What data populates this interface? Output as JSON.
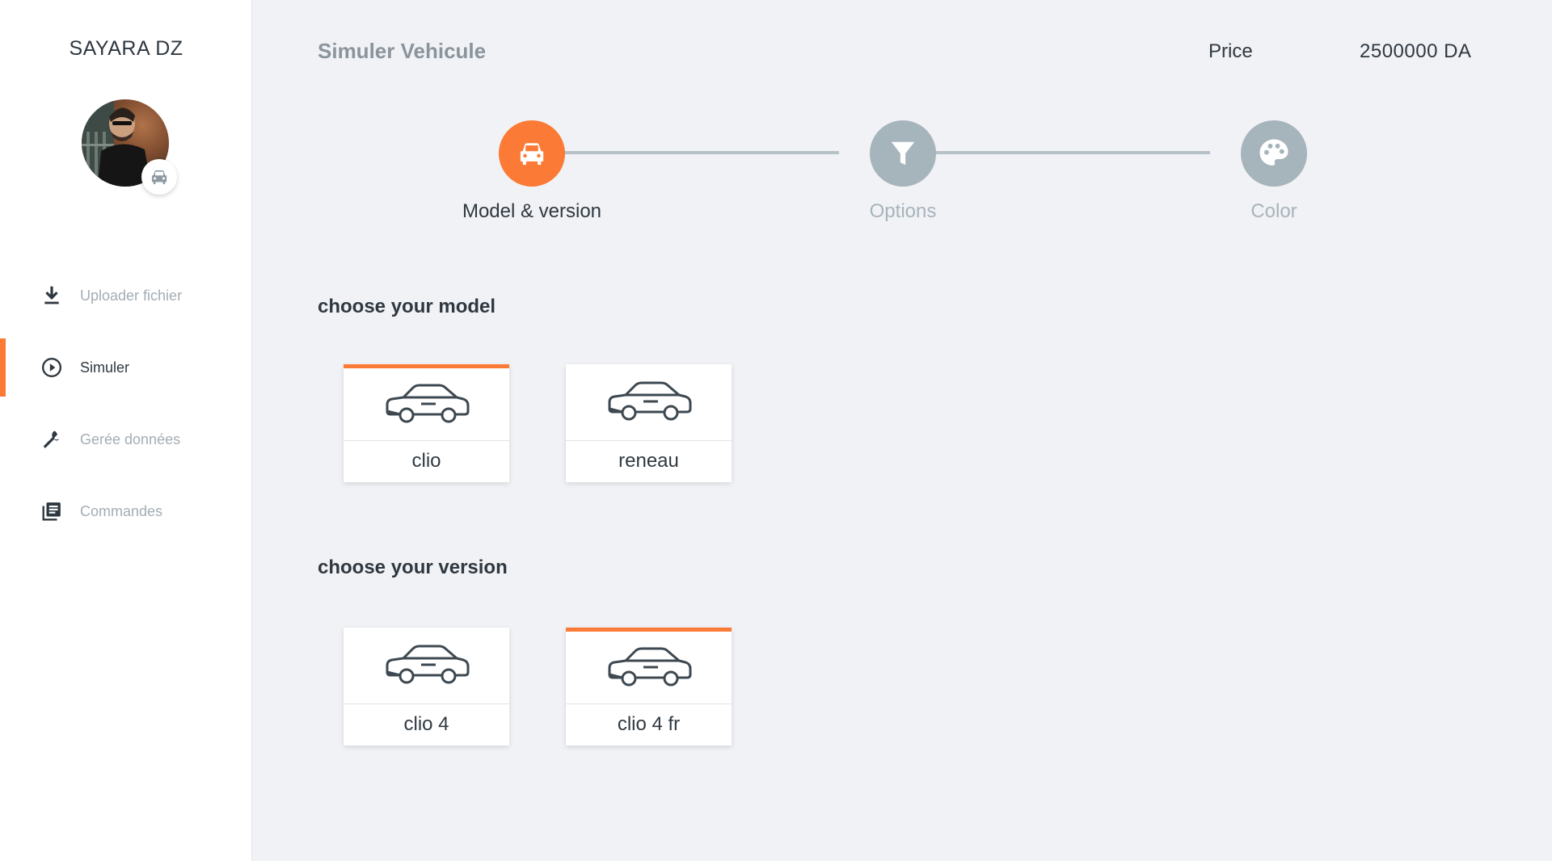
{
  "app": {
    "brand": "SAYARA DZ"
  },
  "sidebar": {
    "items": [
      {
        "label": "Uploader fichier",
        "icon": "download-icon",
        "active": false
      },
      {
        "label": "Simuler",
        "icon": "play-circle-icon",
        "active": true
      },
      {
        "label": "Gerée données",
        "icon": "wrench-icon",
        "active": false
      },
      {
        "label": "Commandes",
        "icon": "list-icon",
        "active": false
      }
    ]
  },
  "header": {
    "title": "Simuler Vehicule",
    "price_label": "Price",
    "price_value": "2500000 DA"
  },
  "stepper": {
    "steps": [
      {
        "label": "Model & version",
        "icon": "car-icon",
        "active": true
      },
      {
        "label": "Options",
        "icon": "filter-icon",
        "active": false
      },
      {
        "label": "Color",
        "icon": "palette-icon",
        "active": false
      }
    ]
  },
  "models": {
    "title": "choose your model",
    "items": [
      {
        "label": "clio",
        "selected": true
      },
      {
        "label": "reneau",
        "selected": false
      }
    ]
  },
  "versions": {
    "title": "choose your version",
    "items": [
      {
        "label": "clio 4",
        "selected": false
      },
      {
        "label": "clio 4 fr",
        "selected": true
      }
    ]
  },
  "colors": {
    "accent": "#fb7a35",
    "inactive_step": "#a6b4bb",
    "text_dark": "#2f3840",
    "text_muted": "#a3adb5",
    "background": "#f1f2f6"
  }
}
